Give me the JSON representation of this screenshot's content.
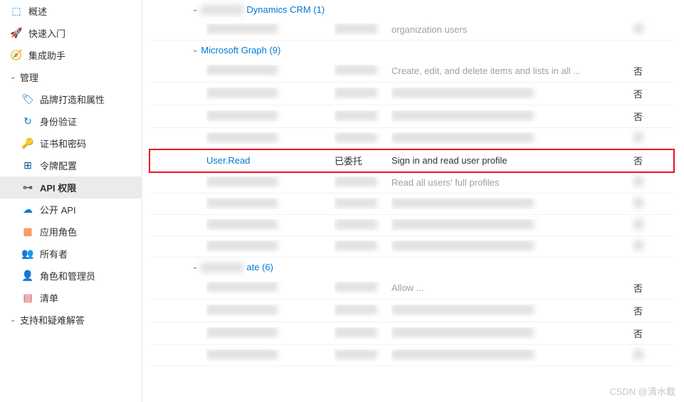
{
  "sidebar": {
    "top": [
      {
        "label": "概述",
        "iconColor": "ic-blue",
        "glyph": "⬚"
      },
      {
        "label": "快速入门",
        "iconColor": "ic-orange",
        "glyph": "🚀"
      },
      {
        "label": "集成助手",
        "iconColor": "ic-teal",
        "glyph": "🧭"
      }
    ],
    "groups": [
      {
        "label": "管理",
        "items": [
          {
            "label": "品牌打造和属性",
            "iconColor": "ic-blue",
            "glyph": "🏷"
          },
          {
            "label": "身份验证",
            "iconColor": "ic-blue",
            "glyph": "↻"
          },
          {
            "label": "证书和密码",
            "iconColor": "ic-yellow",
            "glyph": "🔑"
          },
          {
            "label": "令牌配置",
            "iconColor": "ic-navy",
            "glyph": "⊞"
          },
          {
            "label": "API 权限",
            "iconColor": "ic-gray",
            "glyph": "⊶",
            "active": true
          },
          {
            "label": "公开 API",
            "iconColor": "ic-blue",
            "glyph": "☁"
          },
          {
            "label": "应用角色",
            "iconColor": "ic-orange",
            "glyph": "▦"
          },
          {
            "label": "所有者",
            "iconColor": "ic-blue",
            "glyph": "👥"
          },
          {
            "label": "角色和管理员",
            "iconColor": "ic-green",
            "glyph": "👤"
          },
          {
            "label": "清单",
            "iconColor": "ic-red",
            "glyph": "▤"
          }
        ]
      },
      {
        "label": "支持和疑难解答",
        "items": []
      }
    ]
  },
  "permissions": {
    "groups": [
      {
        "name": "Dynamics CRM (1)",
        "partialBlur": true,
        "rows": [
          {
            "blur": true,
            "admin": "",
            "descHint": "organization users"
          }
        ]
      },
      {
        "name": "Microsoft Graph (9)",
        "rows": [
          {
            "blur": true,
            "admin": "否",
            "descHint": "Create, edit, and delete items and lists in all ..."
          },
          {
            "blur": true,
            "admin": "否"
          },
          {
            "blur": true,
            "admin": "否"
          },
          {
            "blur": true,
            "admin": ""
          },
          {
            "blur": false,
            "name": "User.Read",
            "type": "已委托",
            "desc": "Sign in and read user profile",
            "admin": "否",
            "highlighted": true
          },
          {
            "blur": true,
            "admin": "",
            "descHint": "Read all users' full profiles"
          },
          {
            "blur": true,
            "admin": ""
          },
          {
            "blur": true,
            "admin": ""
          },
          {
            "blur": true,
            "admin": ""
          }
        ]
      },
      {
        "name": "ate (6)",
        "partialBlur": true,
        "rows": [
          {
            "blur": true,
            "admin": "否",
            "typeHint": "已委托",
            "descHint": "Allow ..."
          },
          {
            "blur": true,
            "admin": "否"
          },
          {
            "blur": true,
            "admin": "否"
          },
          {
            "blur": true,
            "admin": ""
          }
        ]
      }
    ]
  },
  "watermark": "CSDN @清水截"
}
